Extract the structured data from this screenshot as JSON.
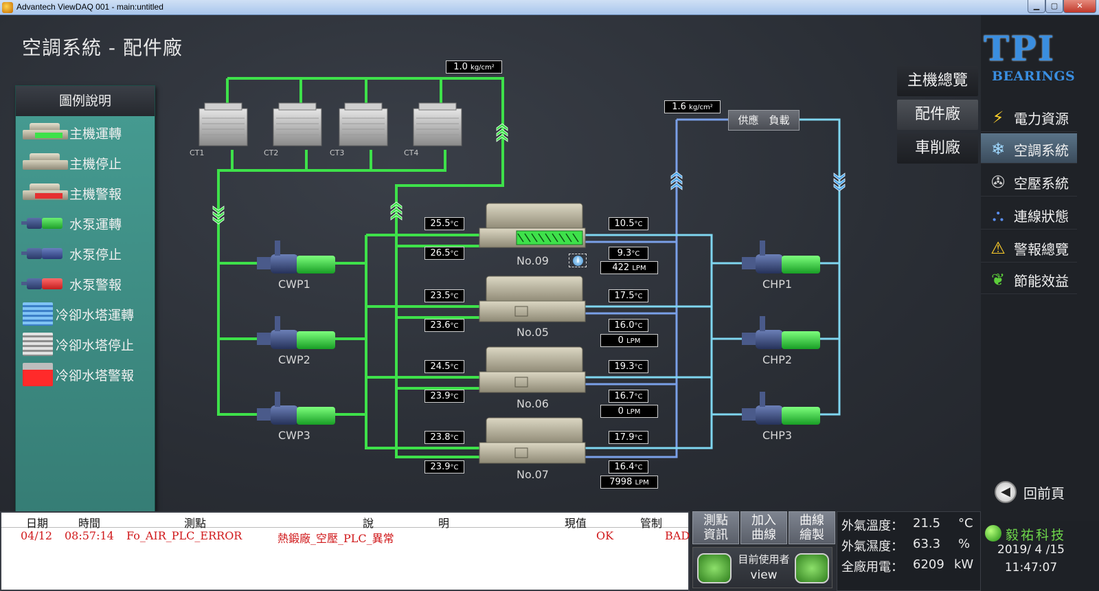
{
  "window": {
    "title": "Advantech ViewDAQ 001 - main:untitled"
  },
  "page": {
    "title": "空調系統 - 配件廠"
  },
  "legend": {
    "title": "圖例說明",
    "items": [
      "主機運轉",
      "主機停止",
      "主機警報",
      "水泵運轉",
      "水泵停止",
      "水泵警報",
      "冷卻水塔運轉",
      "冷卻水塔停止",
      "冷卻水塔警報"
    ]
  },
  "colors": {
    "green": "#3ee14a",
    "blue": "#5b6fc7",
    "cyan": "#7fd6f0",
    "alarm_red": "#e53030",
    "tower_blue": "#4fa6e8"
  },
  "towers": [
    "CT1",
    "CT2",
    "CT3",
    "CT4"
  ],
  "pressure": {
    "cooling": "1.0",
    "chilled": "1.6",
    "unit": "kg/cm²"
  },
  "supply_label": "供應　負載",
  "chillers": [
    {
      "name": "No.09",
      "in_temp": "25.5",
      "out_temp": "26.5",
      "chw_out": "10.5",
      "chw_in": "9.3",
      "flow": "422"
    },
    {
      "name": "No.05",
      "in_temp": "23.5",
      "out_temp": "23.6",
      "chw_out": "17.5",
      "chw_in": "16.0",
      "flow": "0"
    },
    {
      "name": "No.06",
      "in_temp": "24.5",
      "out_temp": "23.9",
      "chw_out": "19.3",
      "chw_in": "16.7",
      "flow": "0"
    },
    {
      "name": "No.07",
      "in_temp": "23.8",
      "out_temp": "23.9",
      "chw_out": "17.9",
      "chw_in": "16.4",
      "flow": "7998"
    }
  ],
  "units": {
    "temp": "°C",
    "flow": "LPM"
  },
  "pumps": {
    "cwp": [
      "CWP1",
      "CWP2",
      "CWP3"
    ],
    "chp": [
      "CHP1",
      "CHP2",
      "CHP3"
    ]
  },
  "plant_tabs": [
    "主機總覽",
    "配件廠",
    "車削廠"
  ],
  "logo": {
    "line1": "TPI",
    "line2": "BEARINGS"
  },
  "sidebar": [
    {
      "label": "電力資源",
      "icon": "lightning-icon"
    },
    {
      "label": "空調系統",
      "icon": "snowflake-icon"
    },
    {
      "label": "空壓系統",
      "icon": "fan-icon"
    },
    {
      "label": "連線狀態",
      "icon": "network-icon"
    },
    {
      "label": "警報總覽",
      "icon": "warning-icon"
    },
    {
      "label": "節能效益",
      "icon": "leaf-icon"
    }
  ],
  "back_label": "回前頁",
  "alarm": {
    "headers": {
      "date": "日期",
      "time": "時間",
      "point": "測點",
      "desc1": "說",
      "desc2": "明",
      "value": "現值",
      "control": "管制"
    },
    "rows": [
      {
        "date": "04/12",
        "time": "08:57:14",
        "point": "Fo_AIR_PLC_ERROR",
        "desc": "熱鍛廠_空壓_PLC_異常",
        "value": "OK",
        "control": "BAD"
      }
    ]
  },
  "buttons": [
    {
      "l1": "測點",
      "l2": "資訊"
    },
    {
      "l1": "加入",
      "l2": "曲線"
    },
    {
      "l1": "曲線",
      "l2": "繪製"
    }
  ],
  "user": {
    "label": "目前使用者",
    "name": "view"
  },
  "weather": {
    "temp_label": "外氣溫度：",
    "temp": "21.5",
    "temp_unit": "°C",
    "hum_label": "外氣濕度：",
    "hum": "63.3",
    "hum_unit": "%",
    "power_label": "全廠用電：",
    "power": "6209",
    "power_unit": "kW"
  },
  "vendor": "毅祐科技",
  "datetime": {
    "date": "2019/ 4 /15",
    "time": "11:47:07"
  }
}
